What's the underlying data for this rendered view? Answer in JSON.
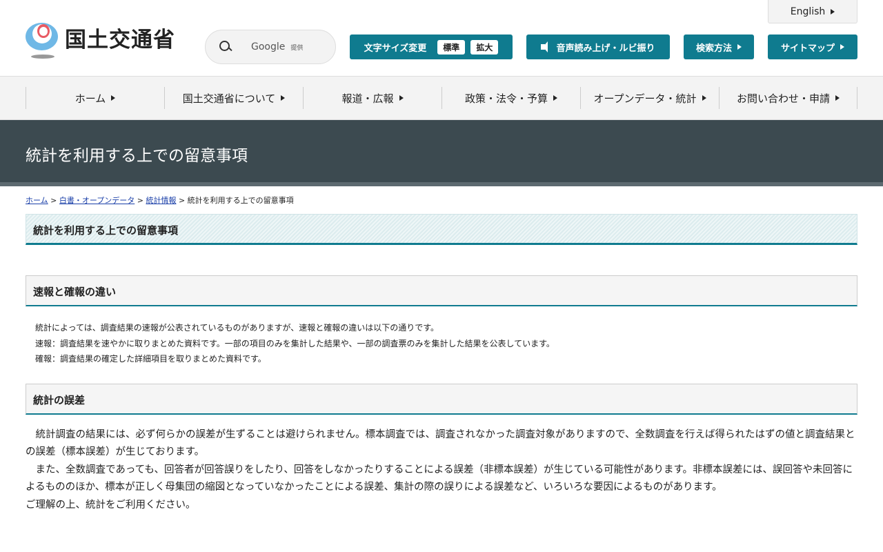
{
  "header": {
    "logo_text": "国土交通省",
    "search_brand": "Google",
    "search_provided": "提供",
    "english": "English",
    "font_size_label": "文字サイズ変更",
    "font_standard": "標準",
    "font_large": "拡大",
    "read_aloud": "音声読み上げ・ルビ振り",
    "search_method": "検索方法",
    "sitemap": "サイトマップ"
  },
  "nav": [
    "ホーム",
    "国土交通省について",
    "報道・広報",
    "政策・法令・予算",
    "オープンデータ・統計",
    "お問い合わせ・申請"
  ],
  "banner": "統計を利用する上での留意事項",
  "breadcrumb": {
    "items": [
      "ホーム",
      "白書・オープンデータ",
      "統計情報"
    ],
    "current": "統計を利用する上での留意事項",
    "sep": ">"
  },
  "page_heading": "統計を利用する上での留意事項",
  "sections": [
    {
      "heading": "速報と確報の違い",
      "lines": [
        "統計によっては、調査結果の速報が公表されているものがありますが、速報と確報の違いは以下の通りです。",
        "速報：調査結果を速やかに取りまとめた資料です。一部の項目のみを集計した結果や、一部の調査票のみを集計した結果を公表しています。",
        "確報：調査結果の確定した詳細項目を取りまとめた資料です。"
      ]
    },
    {
      "heading": "統計の誤差",
      "lines": [
        "　統計調査の結果には、必ず何らかの誤差が生ずることは避けられません。標本調査では、調査されなかった調査対象がありますので、全数調査を行えば得られたはずの値と調査結果との誤差（標本誤差）が生じております。",
        "　また、全数調査であっても、回答者が回答誤りをしたり、回答をしなかったりすることによる誤差（非標本誤差）が生じている可能性があります。非標本誤差には、誤回答や未回答によるもののほか、標本が正しく母集団の縮図となっていなかったことによる誤差、集計の際の誤りによる誤差など、いろいろな要因によるものがあります。",
        "ご理解の上、統計をご利用ください。"
      ]
    }
  ]
}
